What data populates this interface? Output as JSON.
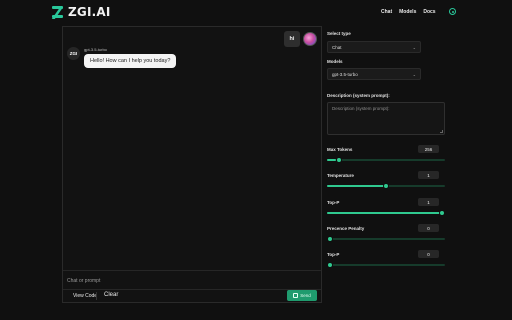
{
  "header": {
    "logo_text": "ZGI.AI",
    "nav": [
      "Chat",
      "Models",
      "Docs"
    ],
    "theme_icon": "globe-icon"
  },
  "chat": {
    "user_message": "hi",
    "bot_avatar_text": "ZGI",
    "bot_model": "gpt-3.5-turbo",
    "bot_message": "Hello! How can I help you today?",
    "prompt_placeholder": "Chat or prompt",
    "prompt_value": "",
    "view_code_label": "View Code",
    "clear_label": "Clear",
    "send_label": "Send"
  },
  "settings": {
    "select_type_label": "Select type",
    "select_type_value": "Chat",
    "models_label": "Models",
    "models_value": "gpt-3.5-turbo",
    "system_prompt_label": "Description (system prompt):",
    "system_prompt_placeholder": "Description (system prompt):",
    "sliders": [
      {
        "label": "Max Tokens",
        "value": "256",
        "fraction": 0.08
      },
      {
        "label": "Temperature",
        "value": "1",
        "fraction": 0.5
      },
      {
        "label": "Top-P",
        "value": "1",
        "fraction": 1.0
      },
      {
        "label": "Precence Penalty",
        "value": "0",
        "fraction": 0.0
      },
      {
        "label": "Top-P",
        "value": "0",
        "fraction": 0.0
      }
    ]
  },
  "colors": {
    "accent": "#2fc98f",
    "background": "#101010"
  }
}
